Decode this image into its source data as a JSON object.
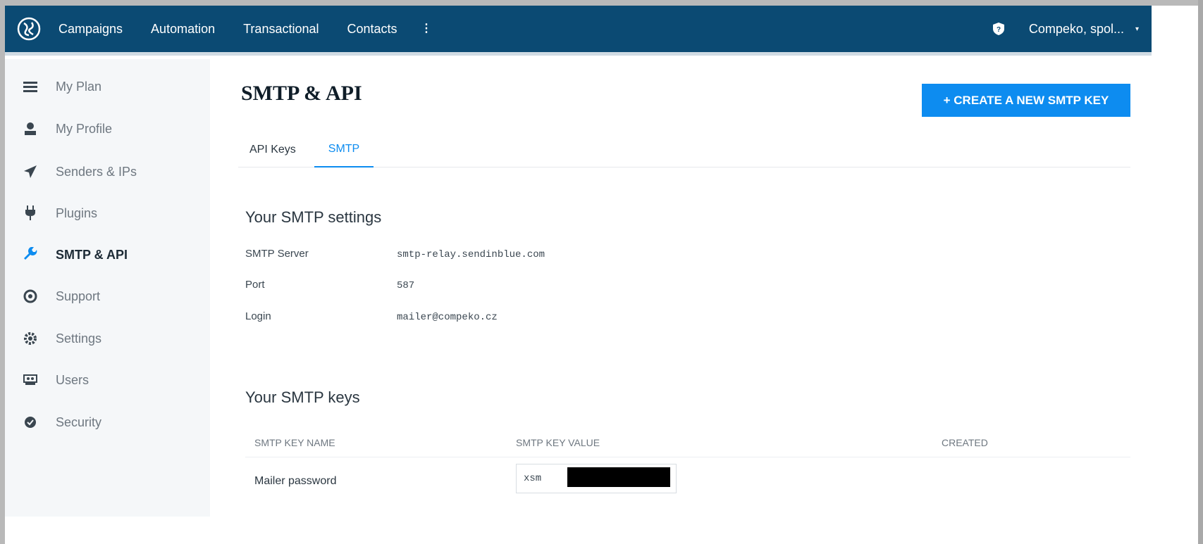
{
  "topnav": {
    "items": [
      "Campaigns",
      "Automation",
      "Transactional",
      "Contacts"
    ],
    "more": "⁝",
    "account": "Compeko, spol...",
    "caret": "▾"
  },
  "sidebar": {
    "items": [
      {
        "label": "My Plan",
        "icon": "menu-icon"
      },
      {
        "label": "My Profile",
        "icon": "user-icon"
      },
      {
        "label": "Senders & IPs",
        "icon": "send-icon"
      },
      {
        "label": "Plugins",
        "icon": "plug-icon"
      },
      {
        "label": "SMTP & API",
        "icon": "wrench-icon",
        "active": true
      },
      {
        "label": "Support",
        "icon": "support-icon"
      },
      {
        "label": "Settings",
        "icon": "gear-icon"
      },
      {
        "label": "Users",
        "icon": "users-icon"
      },
      {
        "label": "Security",
        "icon": "shield-icon"
      }
    ]
  },
  "main": {
    "title": "SMTP & API",
    "create_button": "+ CREATE A NEW SMTP KEY",
    "tabs": [
      "API Keys",
      "SMTP"
    ],
    "settings_title": "Your SMTP settings",
    "settings": [
      {
        "label": "SMTP Server",
        "value": "smtp-relay.sendinblue.com"
      },
      {
        "label": "Port",
        "value": "587"
      },
      {
        "label": "Login",
        "value": "mailer@compeko.cz"
      }
    ],
    "keys_title": "Your SMTP keys",
    "table": {
      "headers": [
        "SMTP KEY NAME",
        "SMTP KEY VALUE",
        "CREATED"
      ],
      "rows": [
        {
          "name": "Mailer password",
          "value_prefix": "xsm",
          "created": ""
        }
      ]
    }
  },
  "colors": {
    "topbar": "#0b4a73",
    "accent": "#0d8cf0",
    "sidebar_bg": "#f5f7f9"
  }
}
